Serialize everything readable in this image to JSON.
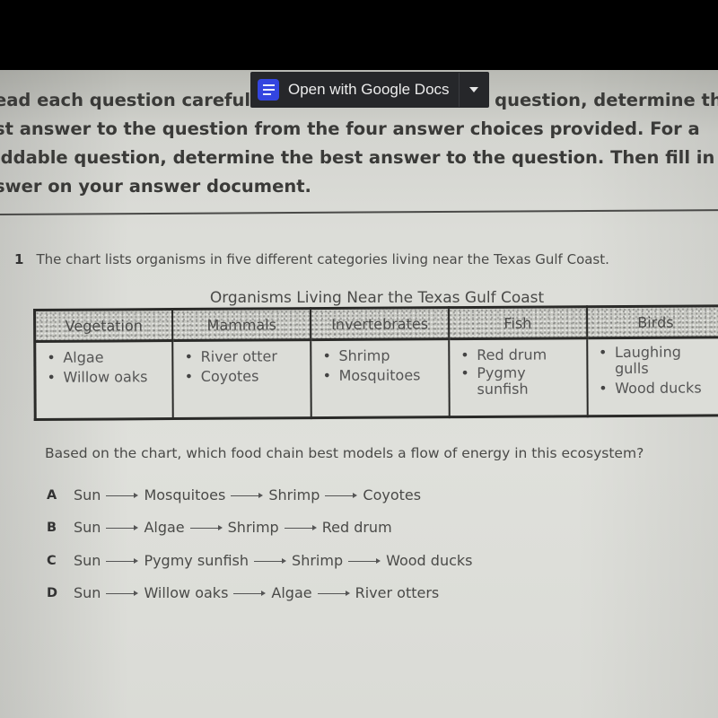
{
  "overlay": {
    "open_with_label": "Open with Google Docs",
    "icon": "google-docs-icon",
    "dropdown_icon": "caret-down-icon"
  },
  "instructions": {
    "lines": [
      "ead each question careful",
      "st answer to the question from the four answer choices provided. For a",
      "iddable question, determine the best answer to the question. Then fill in",
      "swer on your answer document."
    ],
    "line1_right": "question, determine the"
  },
  "question": {
    "number": "1",
    "text": "The chart lists organisms in five different categories living near the Texas Gulf Coast.",
    "chart_title": "Organisms Living Near the Texas Gulf Coast",
    "table": {
      "columns": [
        {
          "header": "Vegetation",
          "items": [
            "Algae",
            "Willow oaks"
          ]
        },
        {
          "header": "Mammals",
          "items": [
            "River otter",
            "Coyotes"
          ]
        },
        {
          "header": "Invertebrates",
          "items": [
            "Shrimp",
            "Mosquitoes"
          ]
        },
        {
          "header": "Fish",
          "items": [
            "Red drum",
            "Pygmy sunfish"
          ]
        },
        {
          "header": "Birds",
          "items": [
            "Laughing gulls",
            "Wood ducks"
          ]
        }
      ]
    },
    "prompt": "Based on the chart, which food chain best models a flow of energy in this ecosystem?",
    "choices": [
      {
        "letter": "A",
        "chain": [
          "Sun",
          "Mosquitoes",
          "Shrimp",
          "Coyotes"
        ]
      },
      {
        "letter": "B",
        "chain": [
          "Sun",
          "Algae",
          "Shrimp",
          "Red drum"
        ]
      },
      {
        "letter": "C",
        "chain": [
          "Sun",
          "Pygmy sunfish",
          "Shrimp",
          "Wood ducks"
        ]
      },
      {
        "letter": "D",
        "chain": [
          "Sun",
          "Willow oaks",
          "Algae",
          "River otters"
        ]
      }
    ]
  }
}
